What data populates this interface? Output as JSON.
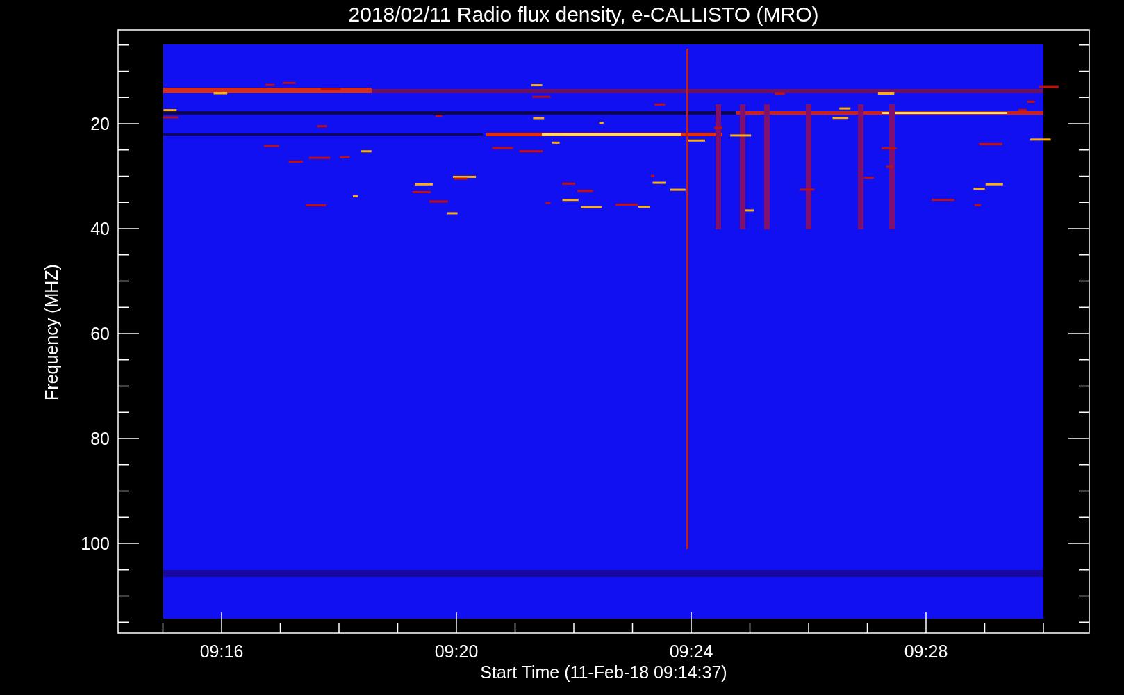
{
  "plot": {
    "title": "2018/02/11  Radio flux density, e-CALLISTO (MRO)",
    "ylabel": "Frequency (MHZ)",
    "xlabel": "Start Time (11-Feb-18 09:14:37)",
    "yticks": [
      "20",
      "40",
      "60",
      "80",
      "100"
    ],
    "xticks": [
      "09:16",
      "09:20",
      "09:24",
      "09:28"
    ]
  }
}
